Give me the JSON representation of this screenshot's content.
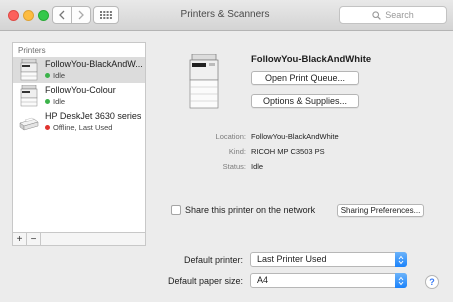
{
  "window": {
    "title": "Printers & Scanners"
  },
  "search": {
    "placeholder": "Search"
  },
  "sidebar": {
    "header": "Printers",
    "items": [
      {
        "name": "FollowYou-BlackAndW...",
        "status": "Idle",
        "status_color": "#3bb34a",
        "selected": true
      },
      {
        "name": "FollowYou-Colour",
        "status": "Idle",
        "status_color": "#3bb34a",
        "selected": false
      },
      {
        "name": "HP DeskJet 3630 series",
        "status": "Offline, Last Used",
        "status_color": "#e0332e",
        "selected": false
      }
    ],
    "add": "+",
    "remove": "−"
  },
  "detail": {
    "title": "FollowYou-BlackAndWhite",
    "open_queue": "Open Print Queue...",
    "options": "Options & Supplies...",
    "location_label": "Location:",
    "location_value": "FollowYou-BlackAndWhite",
    "kind_label": "Kind:",
    "kind_value": "RICOH MP C3503 PS",
    "status_label": "Status:",
    "status_value": "Idle",
    "share_label": "Share this printer on the network",
    "sharing_prefs": "Sharing Preferences..."
  },
  "defaults": {
    "printer_label": "Default printer:",
    "printer_value": "Last Printer Used",
    "paper_label": "Default paper size:",
    "paper_value": "A4"
  },
  "help": "?",
  "colors": {
    "accent": "#1a82fb"
  }
}
